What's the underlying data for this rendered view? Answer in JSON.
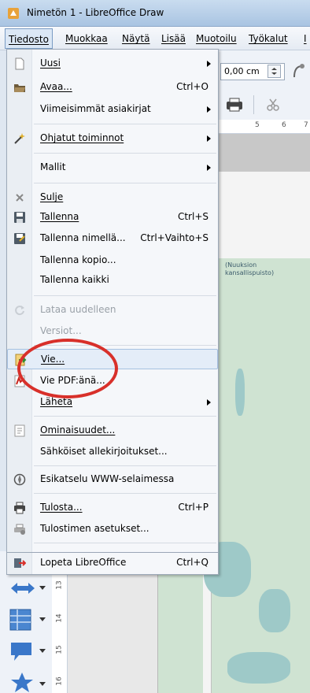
{
  "window": {
    "title": "Nimetön 1 - LibreOffice Draw",
    "app_icon": "libreoffice-draw-icon"
  },
  "menubar": {
    "items": [
      {
        "label": "Tiedosto"
      },
      {
        "label": "Muokkaa"
      },
      {
        "label": "Näytä"
      },
      {
        "label": "Lisää"
      },
      {
        "label": "Muotoilu"
      },
      {
        "label": "Työkalut"
      },
      {
        "label": "I"
      }
    ]
  },
  "toolbar": {
    "position_value": "0,00 cm"
  },
  "ruler": {
    "ticks": [
      "5",
      "6",
      "7"
    ]
  },
  "vertical_ruler": {
    "ticks": [
      "13",
      "14",
      "15",
      "16"
    ]
  },
  "map": {
    "label_line1": "(Nuuksion",
    "label_line2": "kansallispuisto)"
  },
  "file_menu": {
    "items": [
      {
        "label": "Uusi",
        "shortcut": "",
        "submenu": true,
        "icon": "new-document-icon",
        "disabled": false
      },
      {
        "label": "Avaa...",
        "shortcut": "Ctrl+O",
        "submenu": false,
        "icon": "open-folder-icon",
        "disabled": false
      },
      {
        "label": "Viimeisimmät asiakirjat",
        "shortcut": "",
        "submenu": true,
        "icon": "",
        "disabled": false
      },
      {
        "label": "Ohjatut toiminnot",
        "shortcut": "",
        "submenu": true,
        "icon": "wizard-icon",
        "disabled": false
      },
      {
        "label": "Mallit",
        "shortcut": "",
        "submenu": true,
        "icon": "",
        "disabled": false
      },
      {
        "label": "Sulje",
        "shortcut": "",
        "submenu": false,
        "icon": "close-icon",
        "disabled": false
      },
      {
        "label": "Tallenna",
        "shortcut": "Ctrl+S",
        "submenu": false,
        "icon": "save-icon",
        "disabled": false
      },
      {
        "label": "Tallenna nimellä...",
        "shortcut": "Ctrl+Vaihto+S",
        "submenu": false,
        "icon": "save-as-icon",
        "disabled": false
      },
      {
        "label": "Tallenna kopio...",
        "shortcut": "",
        "submenu": false,
        "icon": "",
        "disabled": false
      },
      {
        "label": "Tallenna kaikki",
        "shortcut": "",
        "submenu": false,
        "icon": "",
        "disabled": false
      },
      {
        "label": "Lataa uudelleen",
        "shortcut": "",
        "submenu": false,
        "icon": "reload-icon",
        "disabled": true
      },
      {
        "label": "Versiot...",
        "shortcut": "",
        "submenu": false,
        "icon": "",
        "disabled": true
      },
      {
        "label": "Vie...",
        "shortcut": "",
        "submenu": false,
        "icon": "export-icon",
        "disabled": false
      },
      {
        "label": "Vie PDF:änä...",
        "shortcut": "",
        "submenu": false,
        "icon": "pdf-icon",
        "disabled": false
      },
      {
        "label": "Lähetä",
        "shortcut": "",
        "submenu": true,
        "icon": "",
        "disabled": false
      },
      {
        "label": "Ominaisuudet...",
        "shortcut": "",
        "submenu": false,
        "icon": "properties-icon",
        "disabled": false
      },
      {
        "label": "Sähköiset allekirjoitukset...",
        "shortcut": "",
        "submenu": false,
        "icon": "",
        "disabled": false
      },
      {
        "label": "Esikatselu WWW-selaimessa",
        "shortcut": "",
        "submenu": false,
        "icon": "web-preview-icon",
        "disabled": false
      },
      {
        "label": "Tulosta...",
        "shortcut": "Ctrl+P",
        "submenu": false,
        "icon": "print-icon",
        "disabled": false
      },
      {
        "label": "Tulostimen asetukset...",
        "shortcut": "",
        "submenu": false,
        "icon": "printer-settings-icon",
        "disabled": false
      },
      {
        "label": "Lopeta LibreOffice",
        "shortcut": "Ctrl+Q",
        "submenu": false,
        "icon": "exit-icon",
        "disabled": false
      }
    ]
  },
  "colors": {
    "highlight_circle": "#d8302a",
    "menu_highlight": "#e4edf8"
  }
}
